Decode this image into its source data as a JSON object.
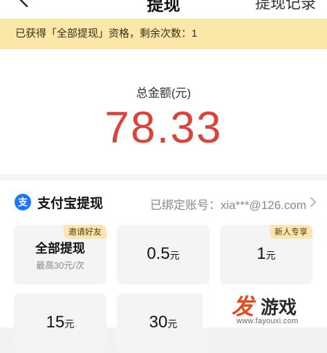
{
  "nav": {
    "title": "提现",
    "right_text": "提现记录"
  },
  "notice": {
    "text": "已获得「全部提现」资格，剩余次数：1"
  },
  "amount": {
    "label": "总金额(元)",
    "value": "78.33"
  },
  "withdraw": {
    "method_icon_text": "支",
    "method_title": "支付宝提现",
    "bound_account": "已绑定账号：xia***@126.com",
    "options": [
      {
        "badge": "邀请好友",
        "title": "全部提现",
        "sub": "最高30元/次"
      },
      {
        "amount": "0.5",
        "unit": "元"
      },
      {
        "badge": "新人专享",
        "amount": "1",
        "unit": "元"
      },
      {
        "amount": "15",
        "unit": "元"
      },
      {
        "amount": "30",
        "unit": "元"
      }
    ]
  },
  "watermark": {
    "logo": "发",
    "name": "游戏",
    "url": "www.fayouxi.com"
  },
  "colors": {
    "accent_red": "#d9443b",
    "notice_bg": "#fbe7a8",
    "badge_bg": "#fbe6b2",
    "alipay_blue": "#1677ff"
  }
}
